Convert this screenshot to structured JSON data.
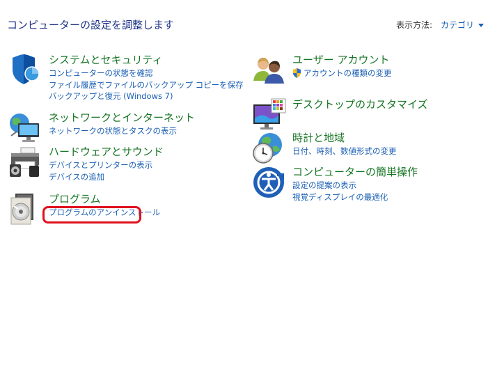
{
  "header": {
    "title": "コンピューターの設定を調整します",
    "view_by_label": "表示方法:",
    "view_by_value": "カテゴリ"
  },
  "categories": {
    "security": {
      "title": "システムとセキュリティ",
      "icon": "security-shield-icon",
      "links": [
        "コンピューターの状態を確認",
        "ファイル履歴でファイルのバックアップ コピーを保存",
        "バックアップと復元 (Windows 7)"
      ]
    },
    "network": {
      "title": "ネットワークとインターネット",
      "icon": "network-globe-icon",
      "links": [
        "ネットワークの状態とタスクの表示"
      ]
    },
    "hardware": {
      "title": "ハードウェアとサウンド",
      "icon": "printer-speaker-icon",
      "links": [
        "デバイスとプリンターの表示",
        "デバイスの追加"
      ]
    },
    "programs": {
      "title": "プログラム",
      "icon": "programs-disc-icon",
      "links": [
        "プログラムのアンインストール"
      ]
    },
    "accounts": {
      "title": "ユーザー アカウント",
      "icon": "user-accounts-icon",
      "links": [
        "アカウントの種類の変更"
      ]
    },
    "appearance": {
      "title": "デスクトップのカスタマイズ",
      "icon": "desktop-monitor-icon",
      "links": []
    },
    "clock": {
      "title": "時計と地域",
      "icon": "clock-globe-icon",
      "links": [
        "日付、時刻、数値形式の変更"
      ]
    },
    "ease": {
      "title": "コンピューターの簡単操作",
      "icon": "ease-of-access-icon",
      "links": [
        "設定の提案の表示",
        "視覚ディスプレイの最適化"
      ]
    }
  },
  "colors": {
    "title_blue": "#1e3287",
    "link_blue": "#1a5fb4",
    "category_green": "#157523",
    "highlight_red": "#e0101e"
  }
}
